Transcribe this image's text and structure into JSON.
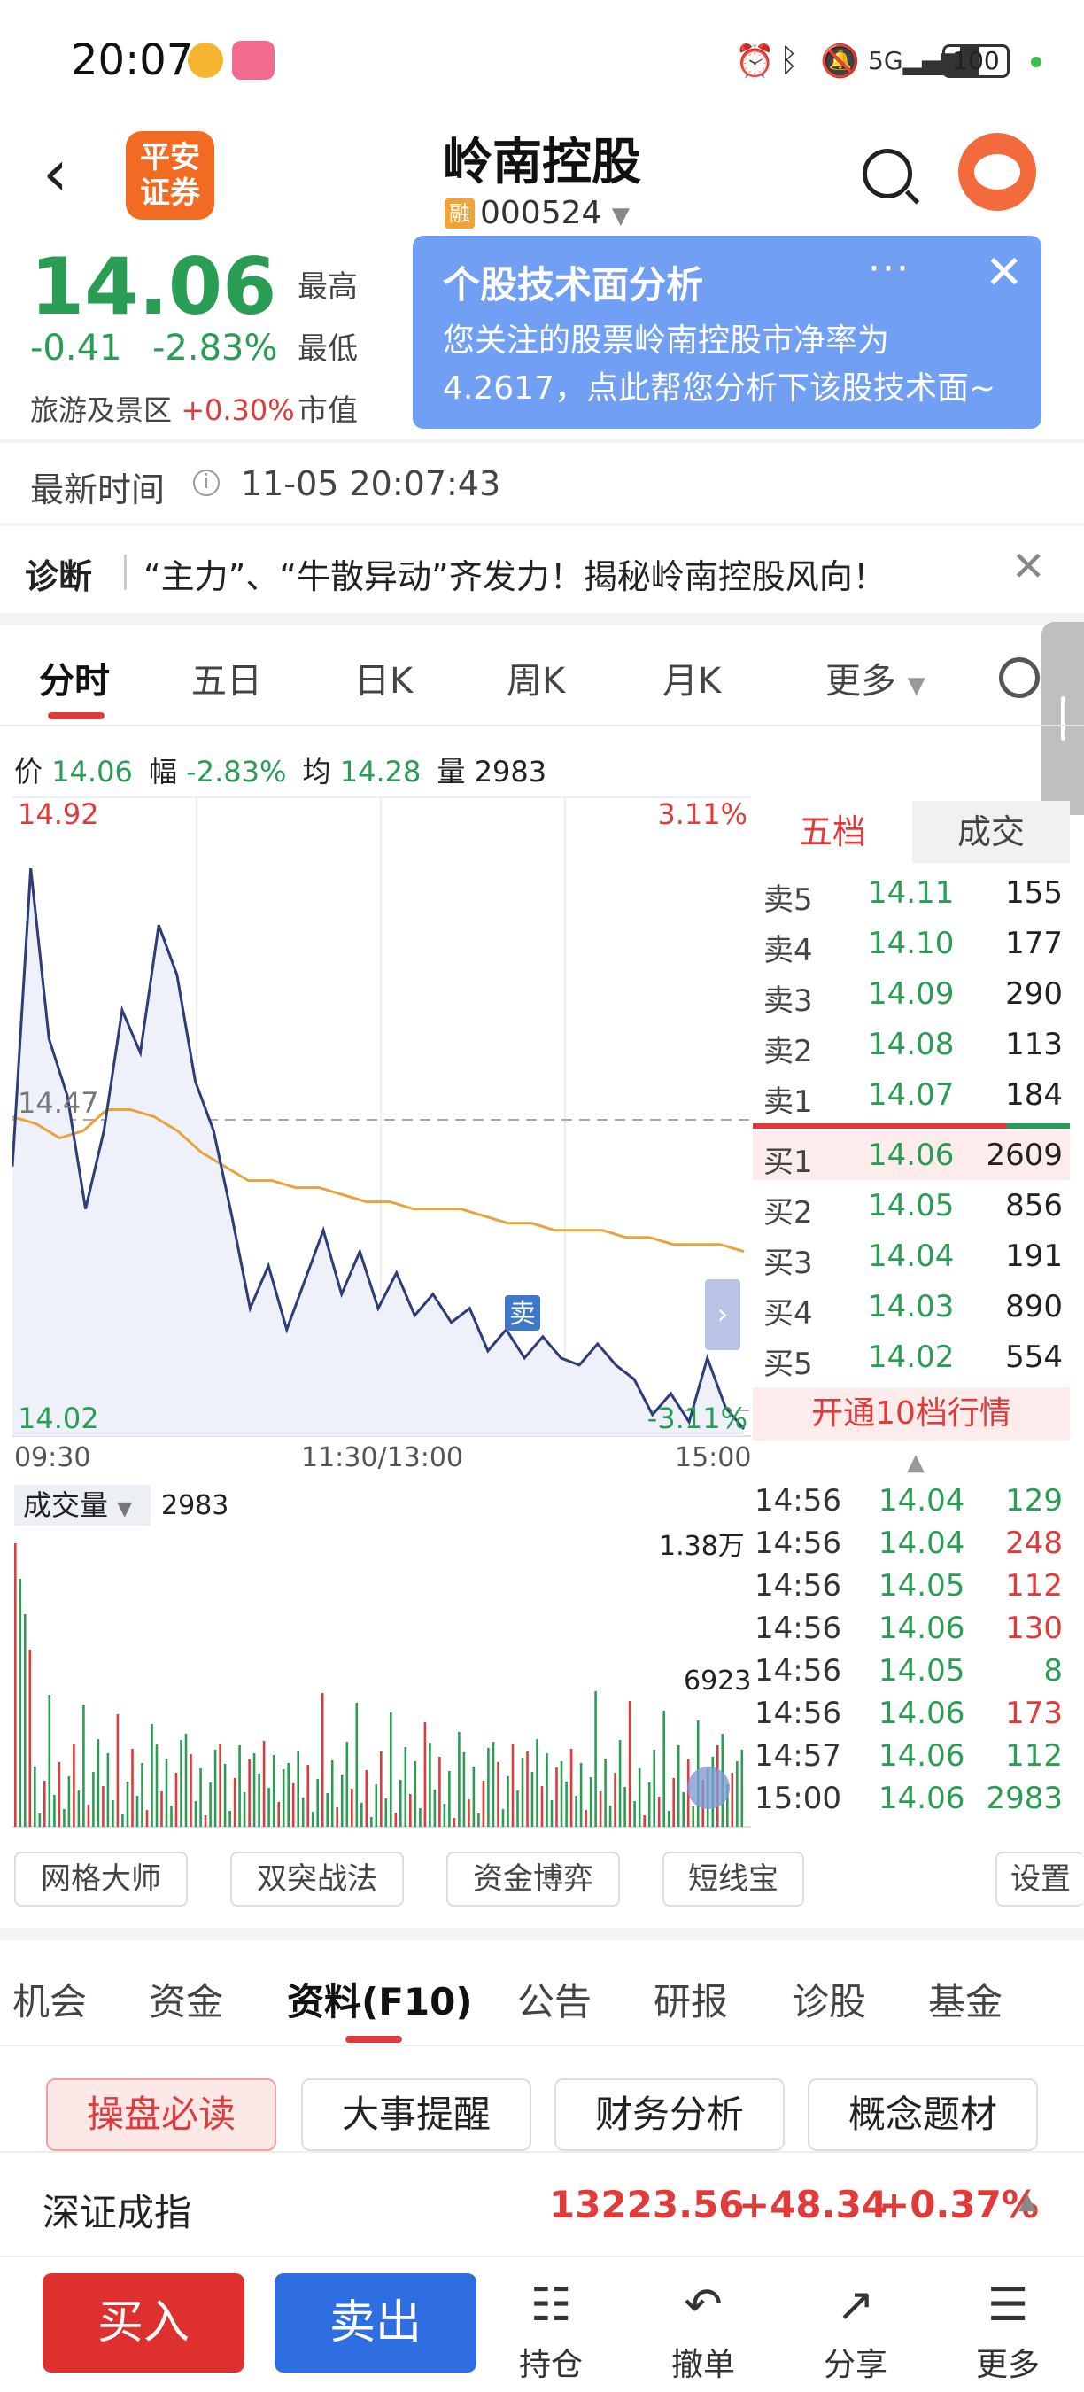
{
  "status_bar": {
    "time": "20:07",
    "battery": "100"
  },
  "header": {
    "broker_logo": "平安\n证券",
    "stock_name": "岭南控股",
    "margin_tag": "融",
    "stock_code": "000524"
  },
  "quote": {
    "price": "14.06",
    "change": "-0.41",
    "change_pct": "-2.83%",
    "sector_name": "旅游及景区",
    "sector_pct": "+0.30%",
    "labels": {
      "high": "最高",
      "low": "最低",
      "cap": "市值"
    }
  },
  "popup": {
    "title": "个股技术面分析",
    "text": "您关注的股票岭南控股市净率为4.2617，点此帮您分析下该股技术面~",
    "more": "···",
    "close": "✕"
  },
  "update": {
    "label": "最新时间",
    "time": "11-05 20:07:43"
  },
  "diagnosis": {
    "label": "诊断",
    "text": "“主力”、“牛散异动”齐发力！揭秘岭南控股风向！"
  },
  "chart_tabs": [
    "分时",
    "五日",
    "日K",
    "周K",
    "月K",
    "更多"
  ],
  "price_row": {
    "price_label": "价",
    "price": "14.06",
    "amp_label": "幅",
    "amp": "-2.83%",
    "avg_label": "均",
    "avg": "14.28",
    "vol_label": "量",
    "vol": "2983"
  },
  "chart_axes": {
    "y_top": "14.92",
    "y_top_pct": "3.11%",
    "y_ref": "14.47",
    "y_bottom": "14.02",
    "y_bottom_pct": "-3.11%",
    "x_start": "09:30",
    "x_mid": "11:30/13:00",
    "x_end": "15:00",
    "sell_marker": "卖"
  },
  "chart_data": {
    "type": "line",
    "series": [
      {
        "values": [
          14.4,
          14.82,
          14.58,
          14.5,
          14.34,
          14.45,
          14.62,
          14.56,
          14.74,
          14.67,
          14.52,
          14.45,
          14.33,
          14.2,
          14.26,
          14.17,
          14.24,
          14.31,
          14.22,
          14.28,
          14.2,
          14.25,
          14.19,
          14.22,
          14.18,
          14.2,
          14.14,
          14.17,
          14.13,
          14.16,
          14.13,
          14.12,
          14.15,
          14.12,
          14.1,
          14.05,
          14.08,
          14.04,
          14.13,
          14.06,
          14.03
        ]
      },
      {
        "values": [
          14.47,
          14.46,
          14.44,
          14.45,
          14.48,
          14.48,
          14.47,
          14.45,
          14.42,
          14.4,
          14.38,
          14.38,
          14.37,
          14.37,
          14.36,
          14.35,
          14.35,
          14.34,
          14.34,
          14.34,
          14.33,
          14.32,
          14.32,
          14.31,
          14.31,
          14.31,
          14.3,
          14.3,
          14.29,
          14.29,
          14.29,
          14.28
        ]
      }
    ],
    "ylim": [
      14.02,
      14.92
    ],
    "ref_price": 14.47
  },
  "order_book": {
    "tabs": [
      "五档",
      "成交"
    ],
    "asks": [
      {
        "label": "卖5",
        "price": "14.11",
        "vol": "155"
      },
      {
        "label": "卖4",
        "price": "14.10",
        "vol": "177"
      },
      {
        "label": "卖3",
        "price": "14.09",
        "vol": "290"
      },
      {
        "label": "卖2",
        "price": "14.08",
        "vol": "113"
      },
      {
        "label": "卖1",
        "price": "14.07",
        "vol": "184"
      }
    ],
    "bids": [
      {
        "label": "买1",
        "price": "14.06",
        "vol": "2609"
      },
      {
        "label": "买2",
        "price": "14.05",
        "vol": "856"
      },
      {
        "label": "买3",
        "price": "14.04",
        "vol": "191"
      },
      {
        "label": "买4",
        "price": "14.03",
        "vol": "890"
      },
      {
        "label": "买5",
        "price": "14.02",
        "vol": "554"
      }
    ],
    "open_l2": "开通10档行情"
  },
  "ticks": [
    {
      "time": "14:56",
      "price": "14.04",
      "vol": "129"
    },
    {
      "time": "14:56",
      "price": "14.04",
      "vol": "248"
    },
    {
      "time": "14:56",
      "price": "14.05",
      "vol": "112"
    },
    {
      "time": "14:56",
      "price": "14.06",
      "vol": "130"
    },
    {
      "time": "14:56",
      "price": "14.05",
      "vol": "8"
    },
    {
      "time": "14:56",
      "price": "14.06",
      "vol": "173"
    },
    {
      "time": "14:57",
      "price": "14.06",
      "vol": "112"
    },
    {
      "time": "15:00",
      "price": "14.06",
      "vol": "2983"
    }
  ],
  "volume": {
    "label": "成交量",
    "value": "2983",
    "max": "1.38万",
    "mid": "6923"
  },
  "tools": [
    "网格大师",
    "双突战法",
    "资金博弈",
    "短线宝",
    "设置"
  ],
  "bottom_tabs": [
    "机会",
    "资金",
    "资料(F10)",
    "公告",
    "研报",
    "诊股",
    "基金"
  ],
  "sub_buttons": [
    "操盘必读",
    "大事提醒",
    "财务分析",
    "概念题材"
  ],
  "index_bar": {
    "name": "深证成指",
    "value": "13223.56",
    "change": "+48.34",
    "pct": "+0.37%"
  },
  "nav": {
    "buy": "买入",
    "sell": "卖出",
    "items": [
      {
        "label": "持仓",
        "icon": "position-icon"
      },
      {
        "label": "撤单",
        "icon": "cancel-order-icon"
      },
      {
        "label": "分享",
        "icon": "share-icon"
      },
      {
        "label": "更多",
        "icon": "more-icon"
      }
    ]
  },
  "colors": {
    "up": "#e03a3a",
    "down": "#2a9d54",
    "price_line": "#2c3d7a",
    "avg_line": "#e8a33c",
    "accent": "#2f6ee0"
  }
}
